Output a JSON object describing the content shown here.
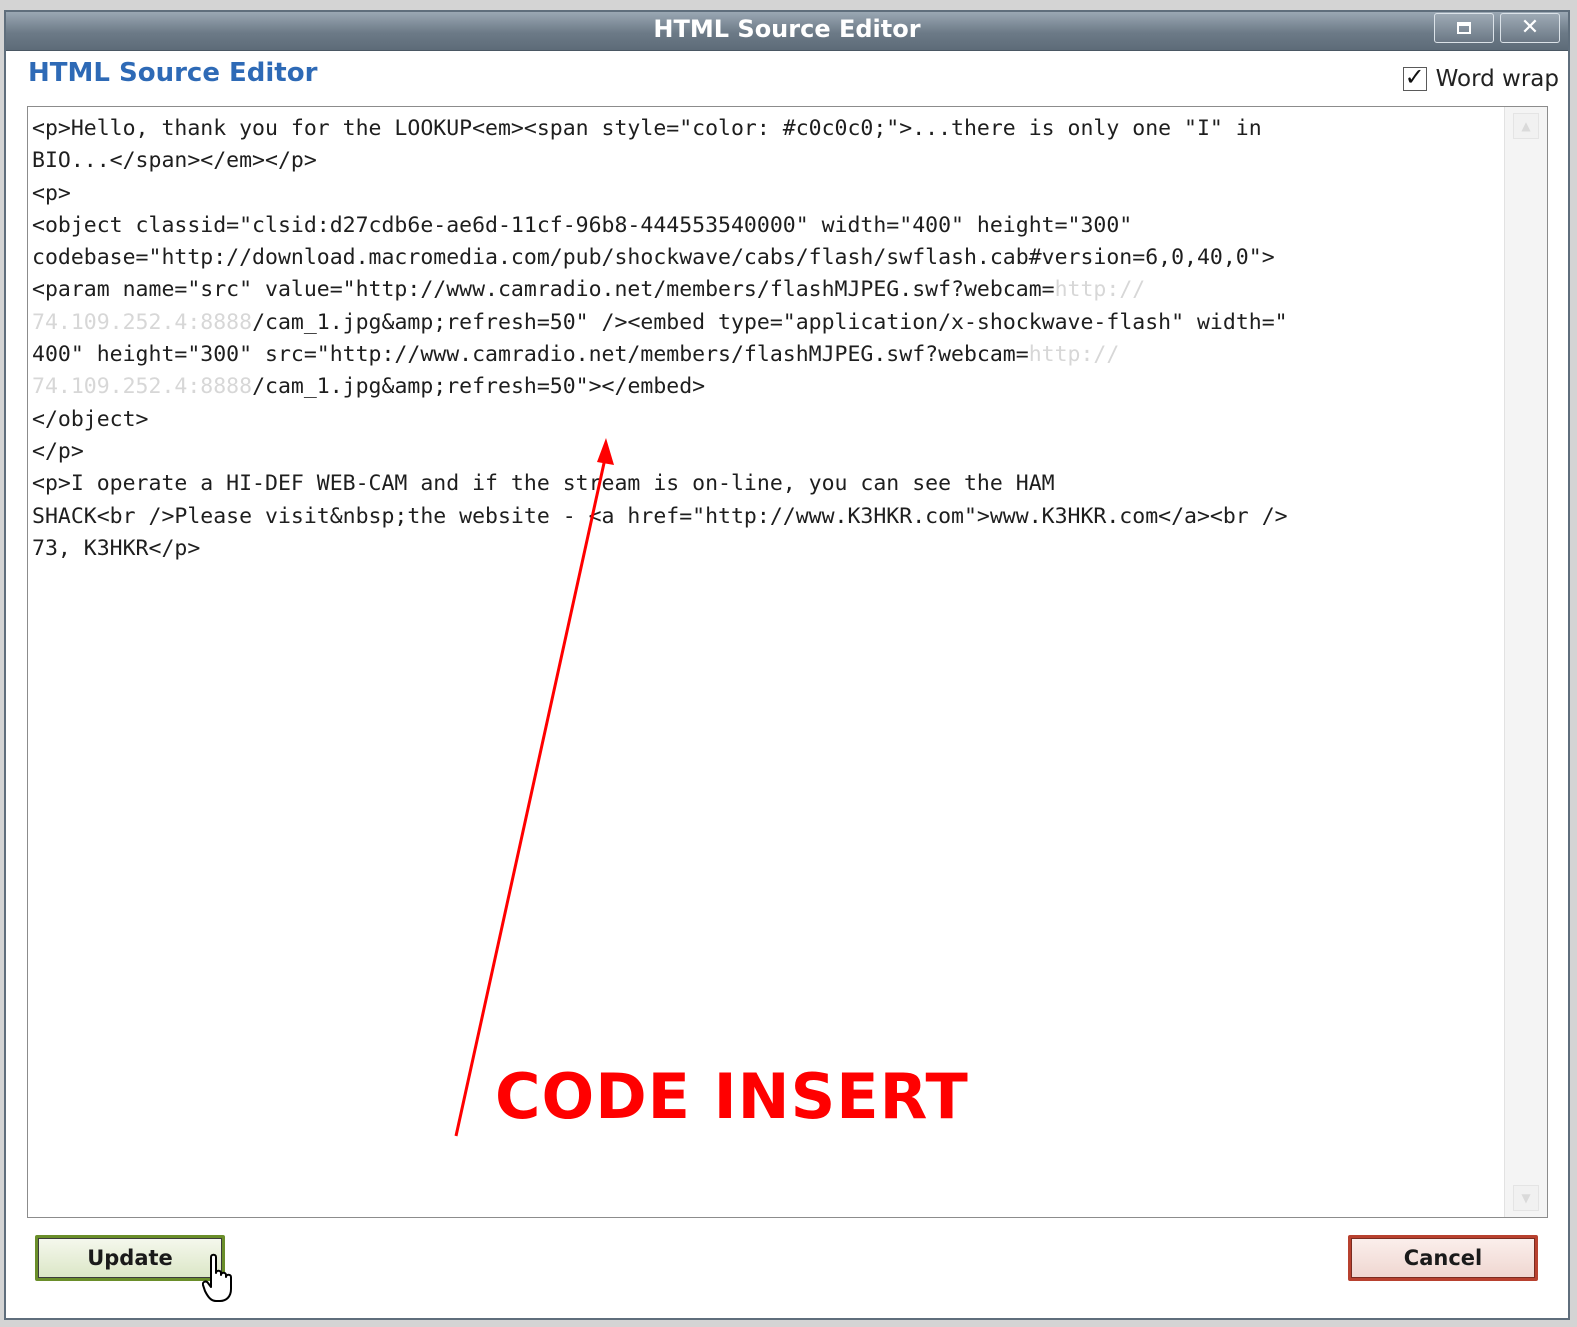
{
  "window": {
    "title": "HTML Source Editor"
  },
  "dialog": {
    "heading": "HTML Source Editor",
    "word_wrap": {
      "label": "Word wrap",
      "checked": true
    }
  },
  "editor": {
    "lines": [
      {
        "text": "<p>Hello, thank you for the LOOKUP<em><span style=\"color: #c0c0c0;\">...there is only one \"I\" in"
      },
      {
        "text": "BIO...</span></em></p>"
      },
      {
        "text": "<p>"
      },
      {
        "text": "<object classid=\"clsid:d27cdb6e-ae6d-11cf-96b8-444553540000\" width=\"400\" height=\"300\""
      },
      {
        "text": "codebase=\"http://download.macromedia.com/pub/shockwave/cabs/flash/swflash.cab#version=6,0,40,0\">"
      },
      {
        "text": "<param name=\"src\" value=\"http://www.camradio.net/members/flashMJPEG.swf?webcam=",
        "faded": "http://"
      },
      {
        "faded_lead": "74.109.252.4:8888",
        "text": "/cam_1.jpg&amp;refresh=50\" /><embed type=\"application/x-shockwave-flash\" width=\""
      },
      {
        "text": "400\" height=\"300\" src=\"http://www.camradio.net/members/flashMJPEG.swf?webcam=",
        "faded": "http://"
      },
      {
        "faded_lead": "74.109.252.4:8888",
        "text": "/cam_1.jpg&amp;refresh=50\"></embed>"
      },
      {
        "text": "</object>"
      },
      {
        "text": "</p>"
      },
      {
        "text": "<p>I operate a HI-DEF WEB-CAM and if the stream is on-line, you can see the HAM"
      },
      {
        "text": "SHACK<br />Please visit&nbsp;the website - <a href=\"http://www.K3HKR.com\">www.K3HKR.com</a><br />"
      },
      {
        "text": "73, K3HKR</p>"
      }
    ]
  },
  "annotation": {
    "text": "CODE INSERT",
    "color": "#ff0000"
  },
  "buttons": {
    "update_label": "Update",
    "cancel_label": "Cancel"
  },
  "colors": {
    "heading": "#2e6ab6",
    "titlebar": "#6c7a87",
    "update_border": "#6a8e2a",
    "cancel_border": "#b8412f"
  }
}
